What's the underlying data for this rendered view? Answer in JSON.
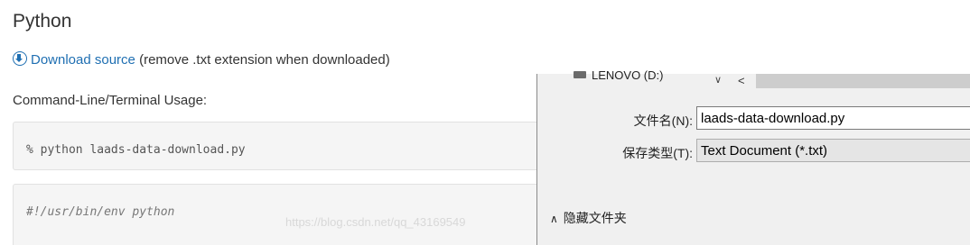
{
  "doc": {
    "section_title": "Python",
    "download": {
      "icon": "download-circle-icon",
      "link_text": "Download source",
      "note": "(remove .txt extension when downloaded)"
    },
    "usage_label": "Command-Line/Terminal Usage:",
    "command": "% python laads-data-download.py",
    "script_first_line": "#!/usr/bin/env python",
    "watermark": "https://blog.csdn.net/qq_43169549"
  },
  "save_dialog": {
    "nav_drive_label": "LENOVO (D:)",
    "dropdown_icon": "chevron-down-icon",
    "scroll_left_icon": "chevron-left-icon",
    "filename_label": "文件名(N):",
    "filename_value": "laads-data-download.py",
    "filetype_label": "保存类型(T):",
    "filetype_value": "Text Document (*.txt)",
    "hide_folders_label": "隐藏文件夹",
    "hide_folders_icon": "chevron-up-icon"
  },
  "colors": {
    "link": "#1f6fb2",
    "code_bg": "#f5f5f5",
    "dialog_bg": "#f0f0f0"
  }
}
